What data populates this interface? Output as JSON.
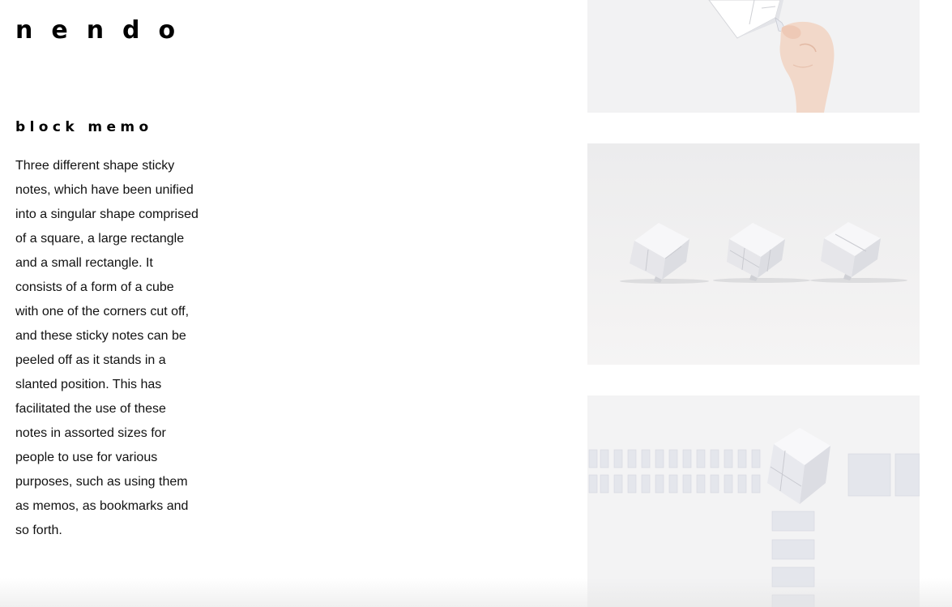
{
  "brand": {
    "logo_text": "nendo"
  },
  "project": {
    "title": "block memo",
    "description": "Three different shape sticky notes, which have been unified into a singular shape comprised of a square, a large rectangle and a small rectangle. It consists of a form of a cube with one of the corners cut off, and these sticky notes can be peeled off as it stands in a slanted position. This has facilitated the use of these notes in assorted sizes for people to use for various purposes, such as using them as memos, as bookmarks and so forth."
  },
  "gallery": {
    "images": [
      {
        "name": "hand-peeling-note-photo"
      },
      {
        "name": "three-cube-memos-photo"
      },
      {
        "name": "peeled-notes-arrangement-photo"
      }
    ]
  },
  "colors": {
    "background": "#ffffff",
    "text": "#111111",
    "photo_background": "#f1f0f1"
  }
}
